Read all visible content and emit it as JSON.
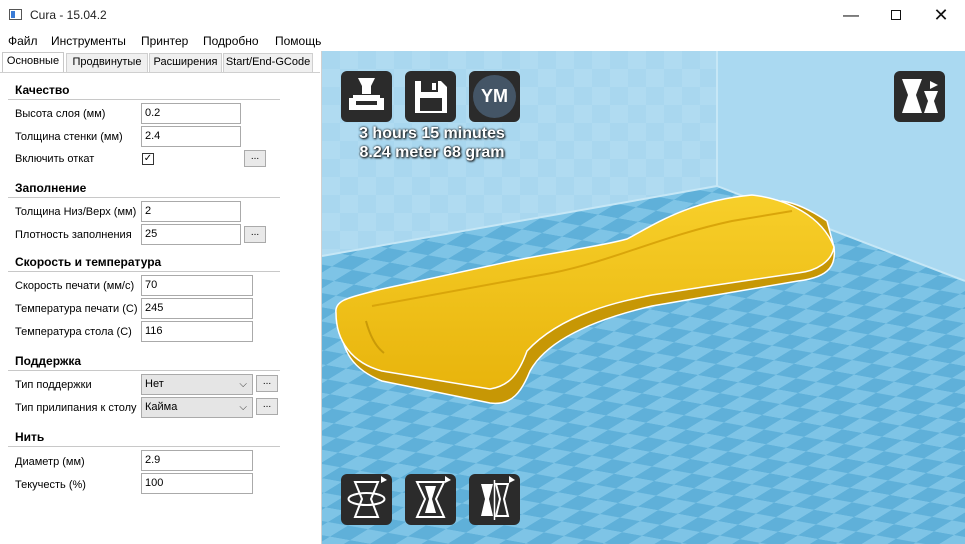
{
  "window": {
    "title": "Cura - 15.04.2"
  },
  "menu": [
    "Файл",
    "Инструменты",
    "Принтер",
    "Подробно",
    "Помощь"
  ],
  "tabs": [
    "Основные",
    "Продвинутые",
    "Расширения",
    "Start/End-GCode"
  ],
  "quality": {
    "heading": "Качество",
    "layer_height_label": "Высота слоя (мм)",
    "layer_height": "0.2",
    "wall_thickness_label": "Толщина стенки (мм)",
    "wall_thickness": "2.4",
    "retraction_label": "Включить откат",
    "retraction_checked": "✓"
  },
  "fill": {
    "heading": "Заполнение",
    "bottom_top_label": "Толщина Низ/Верх (мм)",
    "bottom_top": "2",
    "density_label": "Плотность заполнения",
    "density": "25"
  },
  "speed": {
    "heading": "Скорость и температура",
    "print_speed_label": "Скорость печати (мм/с)",
    "print_speed": "70",
    "print_temp_label": "Температура печати (C)",
    "print_temp": "245",
    "bed_temp_label": "Температура стола (C)",
    "bed_temp": "116"
  },
  "support": {
    "heading": "Поддержка",
    "type_label": "Тип поддержки",
    "type_value": "Нет",
    "adhesion_label": "Тип прилипания к столу",
    "adhesion_value": "Кайма"
  },
  "filament": {
    "heading": "Нить",
    "diameter_label": "Диаметр (мм)",
    "diameter": "2.9",
    "flow_label": "Текучесть (%)",
    "flow": "100"
  },
  "dots_label": "...",
  "viewport": {
    "ym_label": "YM",
    "print_time": "3 hours 15 minutes",
    "print_material": "8.24 meter 68 gram"
  },
  "colors": {
    "model": "#f2c013",
    "floor_light": "#7ec4e6",
    "floor_dark": "#5fb0d9",
    "background": "#b8dff2"
  },
  "icons": [
    "load-model-icon",
    "save-gcode-icon",
    "view-mode-icon",
    "rotate-icon",
    "scale-icon",
    "mirror-icon"
  ]
}
